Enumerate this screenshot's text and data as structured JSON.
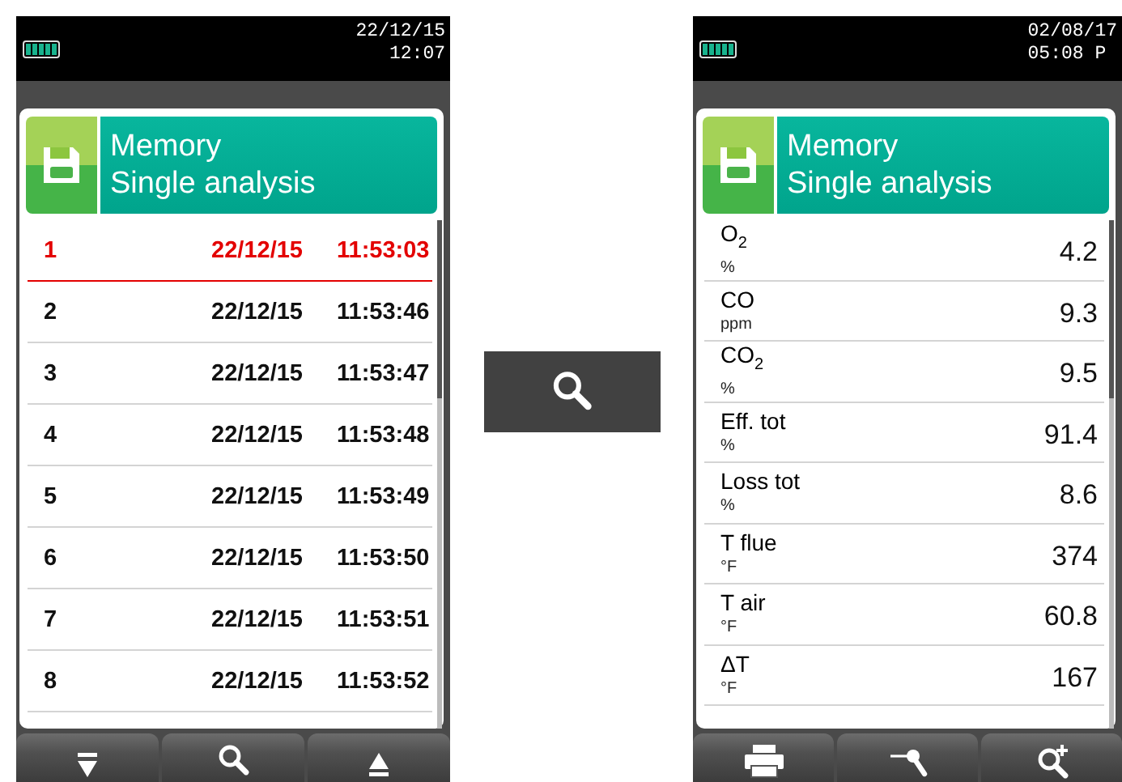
{
  "devices": [
    {
      "status": {
        "date": "22/12/15",
        "time": "12:07"
      },
      "header": {
        "title": "Memory",
        "subtitle": "Single analysis"
      },
      "kind": "records",
      "records": [
        {
          "number": "1",
          "date": "22/12/15",
          "time": "11:53:03",
          "selected": true
        },
        {
          "number": "2",
          "date": "22/12/15",
          "time": "11:53:46",
          "selected": false
        },
        {
          "number": "3",
          "date": "22/12/15",
          "time": "11:53:47",
          "selected": false
        },
        {
          "number": "4",
          "date": "22/12/15",
          "time": "11:53:48",
          "selected": false
        },
        {
          "number": "5",
          "date": "22/12/15",
          "time": "11:53:49",
          "selected": false
        },
        {
          "number": "6",
          "date": "22/12/15",
          "time": "11:53:50",
          "selected": false
        },
        {
          "number": "7",
          "date": "22/12/15",
          "time": "11:53:51",
          "selected": false
        },
        {
          "number": "8",
          "date": "22/12/15",
          "time": "11:53:52",
          "selected": false
        }
      ],
      "toolbar": [
        {
          "kind": "scroll-down"
        },
        {
          "kind": "search"
        },
        {
          "kind": "scroll-up"
        }
      ]
    },
    {
      "status": {
        "date": "02/08/17",
        "time": "05:08 P"
      },
      "header": {
        "title": "Memory",
        "subtitle": "Single analysis"
      },
      "kind": "measurements",
      "measurements": [
        {
          "label": "O$_{2}$",
          "unit": "%",
          "value": "4.2"
        },
        {
          "label": "CO",
          "unit": "ppm",
          "value": "9.3"
        },
        {
          "label": "CO$_{2}$",
          "unit": "%",
          "value": "9.5"
        },
        {
          "label": "Eff. tot",
          "unit": "%",
          "value": "91.4"
        },
        {
          "label": "Loss tot",
          "unit": "%",
          "value": "8.6"
        },
        {
          "label": "T flue",
          "unit": "°F",
          "value": "374"
        },
        {
          "label": "T air",
          "unit": "°F",
          "value": "60.8"
        },
        {
          "label": "ΔT",
          "unit": "°F",
          "value": "167"
        }
      ],
      "toolbar": [
        {
          "kind": "print"
        },
        {
          "kind": "probe"
        },
        {
          "kind": "zoom-in"
        }
      ]
    }
  ],
  "middle_button": {
    "kind": "search"
  }
}
